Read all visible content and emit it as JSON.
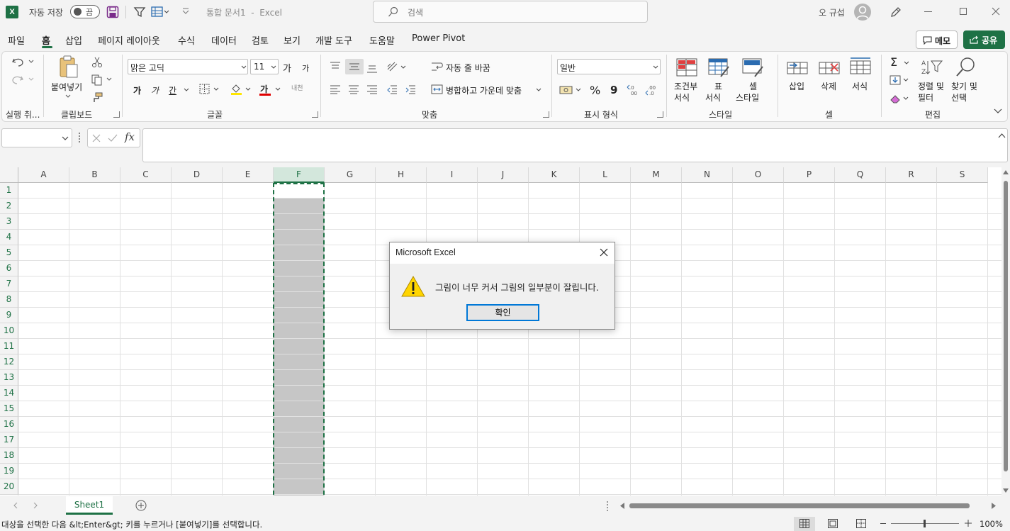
{
  "titlebar": {
    "autosave_label": "자동 저장",
    "autosave_state": "끔",
    "document_title": "통합 문서1  -  Excel",
    "search_placeholder": "검색",
    "user_name": "오 규섭"
  },
  "menu": {
    "items": [
      "파일",
      "홈",
      "삽입",
      "페이지 레이아웃",
      "수식",
      "데이터",
      "검토",
      "보기",
      "개발 도구",
      "도움말",
      "Power Pivot"
    ],
    "active": "홈",
    "memo_label": "메모",
    "share_label": "공유"
  },
  "ribbon": {
    "groups": {
      "undo": "실행 취...",
      "clipboard": "클립보드",
      "font": "글꼴",
      "alignment": "맞춤",
      "number": "표시 형식",
      "styles": "스타일",
      "cells": "셀",
      "editing": "편집"
    },
    "paste_label": "붙여넣기",
    "font_name": "맑은 고딕",
    "font_size": "11",
    "font_grow": "가",
    "font_shrink": "가",
    "bold": "가",
    "italic": "가",
    "underline": "간",
    "font_color_glyph": "가",
    "phonetic": "내천",
    "wrap_text": "자동 줄 바꿈",
    "merge_center": "병합하고 가운데 맞춤",
    "number_format": "일반",
    "percent": "%",
    "comma": "9",
    "cond_format_line1": "조건부",
    "cond_format_line2": "서식",
    "table_format_line1": "표",
    "table_format_line2": "서식",
    "cell_style_line1": "셀",
    "cell_style_line2": "스타일",
    "insert": "삽입",
    "delete": "삭제",
    "format": "서식",
    "sort_filter_line1": "정렬 및",
    "sort_filter_line2": "필터",
    "find_select_line1": "찾기 및",
    "find_select_line2": "선택",
    "sum_glyph": "Σ"
  },
  "formula_bar": {
    "name_box": "",
    "fx": "fx",
    "formula": ""
  },
  "grid": {
    "columns": [
      "A",
      "B",
      "C",
      "D",
      "E",
      "F",
      "G",
      "H",
      "I",
      "J",
      "K",
      "L",
      "M",
      "N",
      "O",
      "P",
      "Q",
      "R",
      "S"
    ],
    "rows": [
      "1",
      "2",
      "3",
      "4",
      "5",
      "6",
      "7",
      "8",
      "9",
      "10",
      "11",
      "12",
      "13",
      "14",
      "15",
      "16",
      "17",
      "18",
      "19",
      "20"
    ],
    "selected_column": "F"
  },
  "sheet_tabs": {
    "tabs": [
      "Sheet1"
    ],
    "active": "Sheet1"
  },
  "status_bar": {
    "message": "대상을 선택한 다음 &lt;Enter&gt; 키를 누르거나 [붙여넣기]를 선택합니다.",
    "zoom": "100%"
  },
  "dialog": {
    "title": "Microsoft Excel",
    "message": "그림이 너무 커서 그림의 일부분이 잘립니다.",
    "ok_label": "확인"
  },
  "colors": {
    "accent": "#1e7145",
    "selection_fill": "#c6c6c6",
    "dialog_button_border": "#0078d7"
  }
}
